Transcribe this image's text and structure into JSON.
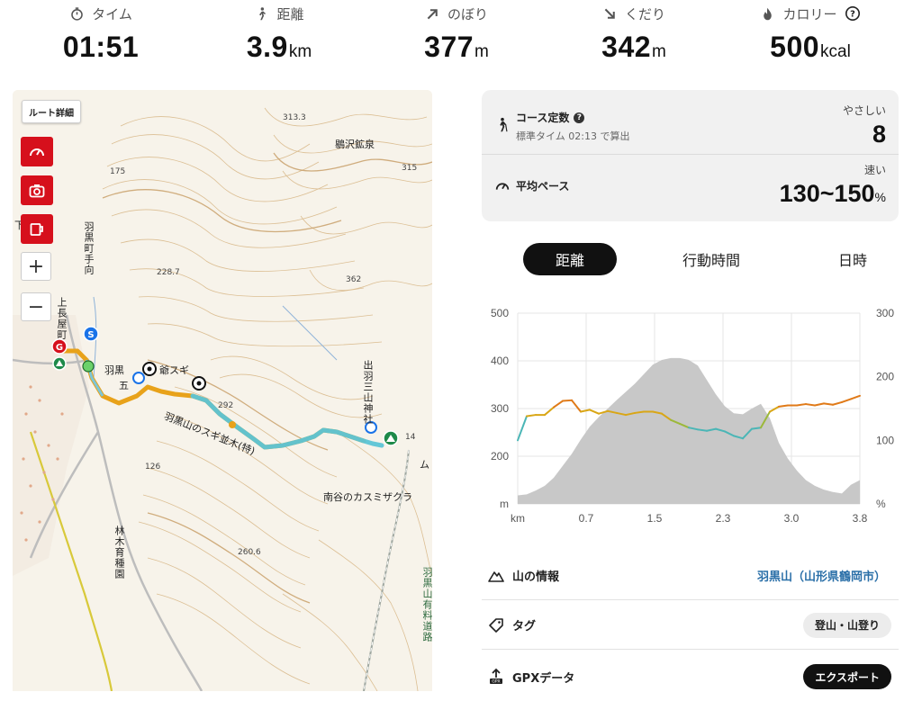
{
  "stats": [
    {
      "label": "タイム",
      "value": "01:51",
      "unit": "",
      "icon": "stopwatch-icon"
    },
    {
      "label": "距離",
      "value": "3.9",
      "unit": "km",
      "icon": "walker-icon"
    },
    {
      "label": "のぼり",
      "value": "377",
      "unit": "m",
      "icon": "arrow-up-right-icon"
    },
    {
      "label": "くだり",
      "value": "342",
      "unit": "m",
      "icon": "arrow-down-right-icon"
    },
    {
      "label": "カロリー",
      "value": "500",
      "unit": "kcal",
      "icon": "flame-icon"
    }
  ],
  "map": {
    "route_detail_button": "ルート詳細",
    "zoom_in": "+",
    "zoom_out": "−",
    "labels": {
      "ikezawa": "鶍沢鉱泉",
      "alt_3133": "313.3",
      "alt_315": "315",
      "alt_175": "175",
      "alt_2287": "228.7",
      "alt_362": "362",
      "alt_292": "292",
      "alt_126": "126",
      "alt_2606": "260.6",
      "alt_14": "14",
      "haguro_town": "羽黒町手向",
      "kamichoja": "上長屋町",
      "shimo": "下",
      "haguro_short": "羽黒",
      "gosugi": "爺スギ",
      "go": "五",
      "sugi_namiki": "羽黒山のスギ並木(特)",
      "dewa_sanzan": "出羽三山神社",
      "minamidani": "南谷のカスミザクラ",
      "rinboku": "林木育種園",
      "toll_road": "羽黒山有料道路",
      "ri": "ム"
    }
  },
  "course": {
    "title": "コース定数",
    "subtitle": "標準タイム 02:13 で算出",
    "difficulty_label": "やさしい",
    "difficulty_value": "8",
    "pace_title": "平均ペース",
    "pace_label": "速い",
    "pace_value": "130~150",
    "pace_unit": "%"
  },
  "tabs": [
    {
      "label": "距離",
      "active": true
    },
    {
      "label": "行動時間",
      "active": false
    },
    {
      "label": "日時",
      "active": false
    }
  ],
  "chart_data": {
    "type": "line",
    "x_unit": "km",
    "x_ticks": [
      "km",
      "0.7",
      "1.5",
      "2.3",
      "3.0",
      "3.8"
    ],
    "y_left_ticks": [
      "500",
      "400",
      "300",
      "200",
      "m"
    ],
    "y_right_ticks": [
      "300",
      "200",
      "100",
      "%"
    ],
    "ylim_left": [
      100,
      500
    ],
    "ylim_right": [
      0,
      300
    ],
    "xlim": [
      0,
      3.8
    ],
    "series": [
      {
        "kind": "area",
        "axis": "left",
        "x": [
          0,
          0.1,
          0.2,
          0.3,
          0.4,
          0.5,
          0.6,
          0.7,
          0.8,
          0.9,
          1.0,
          1.1,
          1.2,
          1.3,
          1.4,
          1.5,
          1.6,
          1.7,
          1.8,
          1.9,
          2.0,
          2.1,
          2.2,
          2.3,
          2.4,
          2.5,
          2.6,
          2.7,
          2.8,
          2.9,
          3.0,
          3.1,
          3.2,
          3.3,
          3.4,
          3.5,
          3.6,
          3.7,
          3.8
        ],
        "values": [
          118,
          120,
          128,
          138,
          155,
          180,
          205,
          235,
          262,
          282,
          300,
          318,
          335,
          352,
          372,
          392,
          402,
          406,
          406,
          402,
          390,
          360,
          330,
          305,
          290,
          288,
          300,
          310,
          280,
          228,
          195,
          170,
          150,
          138,
          130,
          125,
          122,
          140,
          150
        ]
      },
      {
        "kind": "line",
        "axis": "right",
        "x": [
          0,
          0.1,
          0.2,
          0.3,
          0.4,
          0.5,
          0.6,
          0.7,
          0.8,
          0.9,
          1.0,
          1.1,
          1.2,
          1.3,
          1.4,
          1.5,
          1.6,
          1.7,
          1.8,
          1.9,
          2.0,
          2.1,
          2.2,
          2.3,
          2.4,
          2.5,
          2.6,
          2.7,
          2.8,
          2.9,
          3.0,
          3.1,
          3.2,
          3.3,
          3.4,
          3.5,
          3.6,
          3.7,
          3.8
        ],
        "values": [
          100,
          138,
          140,
          140,
          152,
          162,
          163,
          145,
          148,
          142,
          146,
          143,
          140,
          143,
          145,
          145,
          142,
          132,
          126,
          120,
          117,
          115,
          118,
          114,
          107,
          103,
          118,
          120,
          145,
          153,
          155,
          155,
          157,
          155,
          158,
          156,
          160,
          165,
          170
        ]
      }
    ]
  },
  "info": {
    "mountain_label": "山の情報",
    "mountain_value": "羽黒山（山形県鶴岡市）",
    "tag_label": "タグ",
    "tag_value": "登山・山登り",
    "gpx_label": "GPXデータ",
    "gpx_button": "エクスポート"
  },
  "colors": {
    "accent_red": "#d6101c",
    "route_orange": "#e8a21a",
    "route_teal": "#52c0d8",
    "link_blue": "#2a6fa8"
  }
}
